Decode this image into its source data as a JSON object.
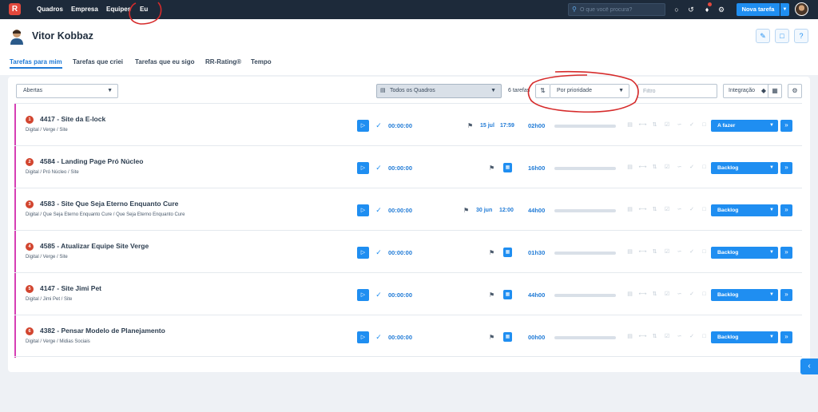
{
  "nav": {
    "logo": "R",
    "links": [
      "Quadros",
      "Empresa",
      "Equipes",
      "Eu"
    ],
    "search_placeholder": "O que você procura?",
    "new_task_label": "Nova tarefa",
    "icons": [
      "lightbulb-icon",
      "history-icon",
      "bell-icon",
      "gear-icon"
    ]
  },
  "profile": {
    "name": "Vitor Kobbaz",
    "actions": [
      "edit-icon",
      "feedback-icon",
      "help-icon"
    ]
  },
  "tabs": [
    {
      "label": "Tarefas para mim",
      "active": true
    },
    {
      "label": "Tarefas que criei",
      "active": false
    },
    {
      "label": "Tarefas que eu sigo",
      "active": false
    },
    {
      "label": "RR-Rating®",
      "active": false
    },
    {
      "label": "Tempo",
      "active": false
    }
  ],
  "filters": {
    "status_value": "Abertas",
    "board_value": "Todos os Quadros",
    "count_label": "6 tarefas",
    "sort_value": "Por prioridade",
    "filter_placeholder": "Filtro",
    "integration_label": "Integração"
  },
  "tasks": [
    {
      "priority": "1",
      "title": "4417 - Site da E-lock",
      "crumb": "Digital / Verge / Site",
      "timer": "00:00:00",
      "date": "15 jul",
      "time": "17:59",
      "hours": "02h00",
      "progress": 0,
      "status": "A fazer"
    },
    {
      "priority": "2",
      "title": "4584 - Landing Page Pró Núcleo",
      "crumb": "Digital / Pró Núcleo / Site",
      "timer": "00:00:00",
      "date": "",
      "time": "",
      "hours": "16h00",
      "progress": 0,
      "status": "Backlog"
    },
    {
      "priority": "3",
      "title": "4583 - Site Que Seja Eterno Enquanto Cure",
      "crumb": "Digital / Que Seja Eterno Enquanto Cure / Que Seja Eterno Enquanto Cure",
      "timer": "00:00:00",
      "date": "30 jun",
      "time": "12:00",
      "hours": "44h00",
      "progress": 0,
      "status": "Backlog"
    },
    {
      "priority": "4",
      "title": "4585 - Atualizar Equipe Site Verge",
      "crumb": "Digital / Verge / Site",
      "timer": "00:00:00",
      "date": "",
      "time": "",
      "hours": "01h30",
      "progress": 0,
      "status": "Backlog"
    },
    {
      "priority": "5",
      "title": "4147 - Site Jimi Pet",
      "crumb": "Digital / Jimi Pet / Site",
      "timer": "00:00:00",
      "date": "",
      "time": "",
      "hours": "44h00",
      "progress": 0,
      "status": "Backlog"
    },
    {
      "priority": "6",
      "title": "4382 - Pensar Modelo de Planejamento",
      "crumb": "Digital / Verge / Midias Sociais",
      "timer": "00:00:00",
      "date": "",
      "time": "",
      "hours": "00h00",
      "progress": 0,
      "status": "Backlog"
    }
  ],
  "colors": {
    "topbar": "#1d2a3a",
    "accent": "#1f8ef1",
    "priority": "#d2452f",
    "stripe": "#d63fb4",
    "annotation": "#d62b2b"
  }
}
